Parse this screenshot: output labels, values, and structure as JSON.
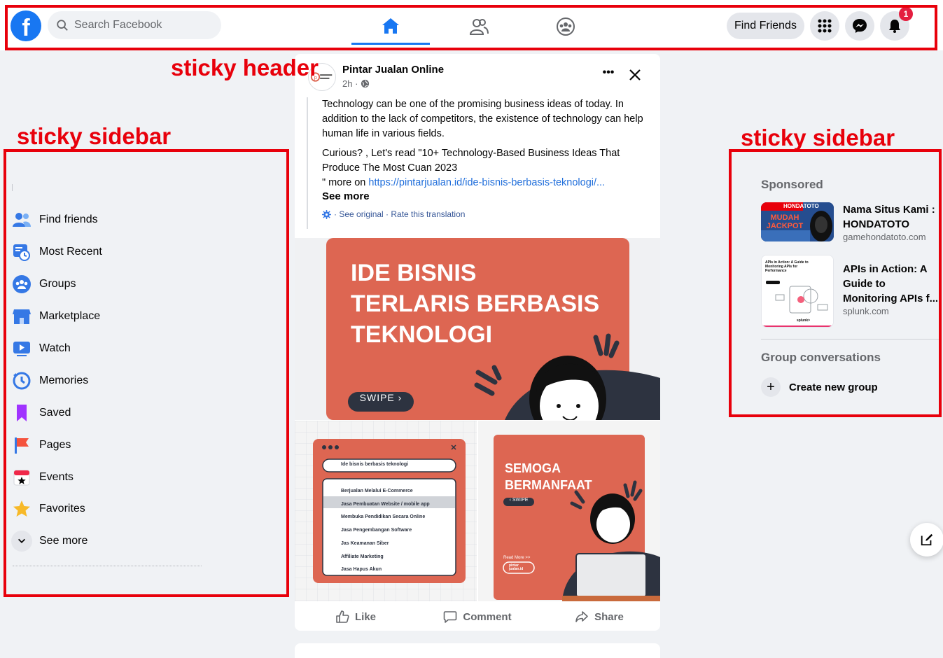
{
  "header": {
    "logo_letter": "f",
    "search_placeholder": "Search Facebook",
    "find_friends_label": "Find Friends",
    "notification_count": "1",
    "tabs": [
      {
        "name": "home",
        "active": true,
        "icon": "home-icon"
      },
      {
        "name": "friends",
        "active": false,
        "icon": "friends-icon"
      },
      {
        "name": "groups",
        "active": false,
        "icon": "groups-icon"
      }
    ],
    "buttons": [
      "menu-grid-icon",
      "messenger-icon",
      "bell-icon"
    ]
  },
  "annotations": {
    "header": "sticky header",
    "left_sidebar": "sticky sidebar",
    "right_sidebar": "sticky sidebar",
    "color": "#e8000b"
  },
  "left_sidebar": {
    "items": [
      {
        "label": "Find friends",
        "icon": "friends-icon"
      },
      {
        "label": "Most Recent",
        "icon": "most-recent-icon"
      },
      {
        "label": "Groups",
        "icon": "groups-icon"
      },
      {
        "label": "Marketplace",
        "icon": "marketplace-icon"
      },
      {
        "label": "Watch",
        "icon": "watch-icon"
      },
      {
        "label": "Memories",
        "icon": "memories-icon"
      },
      {
        "label": "Saved",
        "icon": "saved-icon"
      },
      {
        "label": "Pages",
        "icon": "pages-icon"
      },
      {
        "label": "Events",
        "icon": "events-icon"
      },
      {
        "label": "Favorites",
        "icon": "favorites-icon"
      },
      {
        "label": "See more",
        "icon": "chevron-down-icon"
      }
    ]
  },
  "post": {
    "author": "Pintar Jualan Online",
    "avatar_text": "pintar jualan.id",
    "time": "2h ·",
    "text1": "Technology can be one of the promising business ideas of today. In addition to the lack of competitors, the existence of technology can help human life in various fields.",
    "text2a": "Curious? , Let's read \"10+ Technology-Based Business Ideas That Produce The Most Cuan 2023",
    "text2b": "\" more on ",
    "link": "https://pintarjualan.id/ide-bisnis-berbasis-teknologi/...",
    "see_more": "See more",
    "see_original": "· See original · Rate this translation",
    "image_main": {
      "line1": "IDE BISNIS",
      "line2": "TERLARIS BERBASIS",
      "line3": "TEKNOLOGI",
      "swipe": "SWIPE ›"
    },
    "image_left": {
      "search_text": "Ide bisnis berbasis teknologi",
      "results": [
        "Berjualan Melalui E-Commerce",
        "Jasa Pembuatan Website / mobile app",
        "Membuka Pendidikan Secara Online",
        "Jasa Pengembangan Software",
        "Jas Keamanan Siber",
        "Affiliate Marketing",
        "Jasa Hapus Akun"
      ]
    },
    "image_right": {
      "line1": "SEMOGA",
      "line2": "BERMANFAAT",
      "swipe": "‹ SWIPE",
      "read_more": "Read More >>",
      "brand": "pintar jualan.id"
    },
    "actions": [
      {
        "label": "Like",
        "icon": "like-icon"
      },
      {
        "label": "Comment",
        "icon": "comment-icon"
      },
      {
        "label": "Share",
        "icon": "share-icon"
      }
    ]
  },
  "right_sidebar": {
    "sponsored_heading": "Sponsored",
    "ads": [
      {
        "title": "Nama Situs Kami : HONDATOTO",
        "domain": "gamehondatoto.com",
        "thumb_text": "MUDAH JACKPOT",
        "thumb_top": "HONDATOTO"
      },
      {
        "title": "APIs in Action: A Guide to Monitoring APIs f...",
        "domain": "splunk.com",
        "thumb_text": "APIs in Action: A Guide to Monitoring APIs for Performance",
        "thumb_brand": "splunk>"
      }
    ],
    "group_heading": "Group conversations",
    "new_group_label": "Create new group"
  },
  "colors": {
    "brand_blue": "#1877f2",
    "annotation_red": "#e8000b",
    "graphic_orange": "#dd6652",
    "graphic_dark": "#2d3340"
  }
}
